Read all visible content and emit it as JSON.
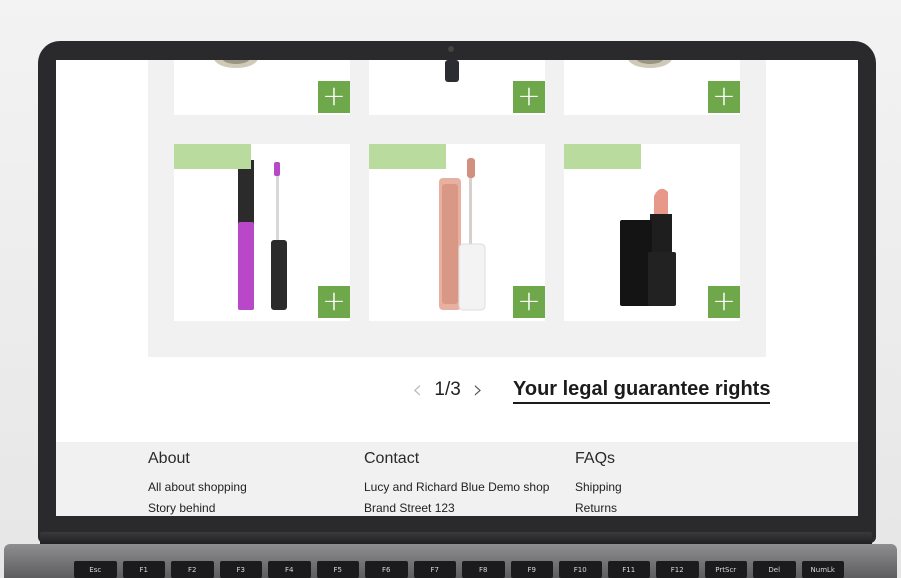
{
  "products": {
    "add_label": "+"
  },
  "pagination": {
    "prev_icon": "‹",
    "current": "1/3",
    "next_icon": "›"
  },
  "link": {
    "guarantee": "Your legal guarantee rights"
  },
  "footer": {
    "about": {
      "title": "About",
      "links": [
        "All about shopping",
        "Story behind"
      ]
    },
    "contact": {
      "title": "Contact",
      "lines": [
        "Lucy and Richard Blue Demo shop",
        "Brand Street 123"
      ]
    },
    "faqs": {
      "title": "FAQs",
      "links": [
        "Shipping",
        "Returns"
      ]
    }
  },
  "keyboard": {
    "keys": [
      "Esc",
      "F1",
      "F2",
      "F3",
      "F4",
      "F5",
      "F6",
      "F7",
      "F8",
      "F9",
      "F10",
      "F11",
      "F12",
      "PrtScr",
      "Del",
      "NumLk"
    ]
  },
  "colors": {
    "accent_green": "#6fa84a",
    "promo_green": "#b9dc9e"
  }
}
